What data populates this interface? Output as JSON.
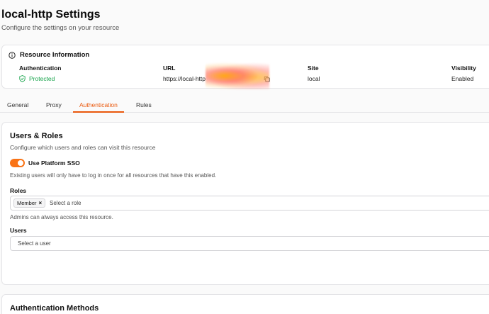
{
  "page": {
    "title": "local-http Settings",
    "subtitle": "Configure the settings on your resource"
  },
  "resource_info": {
    "title": "Resource Information",
    "icon": "info-icon",
    "columns": [
      {
        "label": "Authentication",
        "value": "Protected",
        "icon": "shield-check-icon",
        "color": "#16a34a"
      },
      {
        "label": "URL",
        "value": "https://local-http",
        "icon": "copy-icon"
      },
      {
        "label": "Site",
        "value": "local"
      },
      {
        "label": "Visibility",
        "value": "Enabled"
      }
    ]
  },
  "tabs": [
    {
      "label": "General",
      "active": false
    },
    {
      "label": "Proxy",
      "active": false
    },
    {
      "label": "Authentication",
      "active": true
    },
    {
      "label": "Rules",
      "active": false
    }
  ],
  "users_roles": {
    "title": "Users & Roles",
    "subtitle": "Configure which users and roles can visit this resource",
    "sso_toggle": {
      "label": "Use Platform SSO",
      "on": true
    },
    "sso_hint": "Existing users will only have to log in once for all resources that have this enabled.",
    "roles": {
      "label": "Roles",
      "chips": [
        "Member"
      ],
      "placeholder": "Select a role",
      "hint": "Admins can always access this resource."
    },
    "users": {
      "label": "Users",
      "placeholder": "Select a user"
    }
  },
  "auth_methods": {
    "title": "Authentication Methods"
  },
  "colors": {
    "accent": "#ea580c",
    "toggle": "#f97316",
    "success": "#16a34a"
  }
}
